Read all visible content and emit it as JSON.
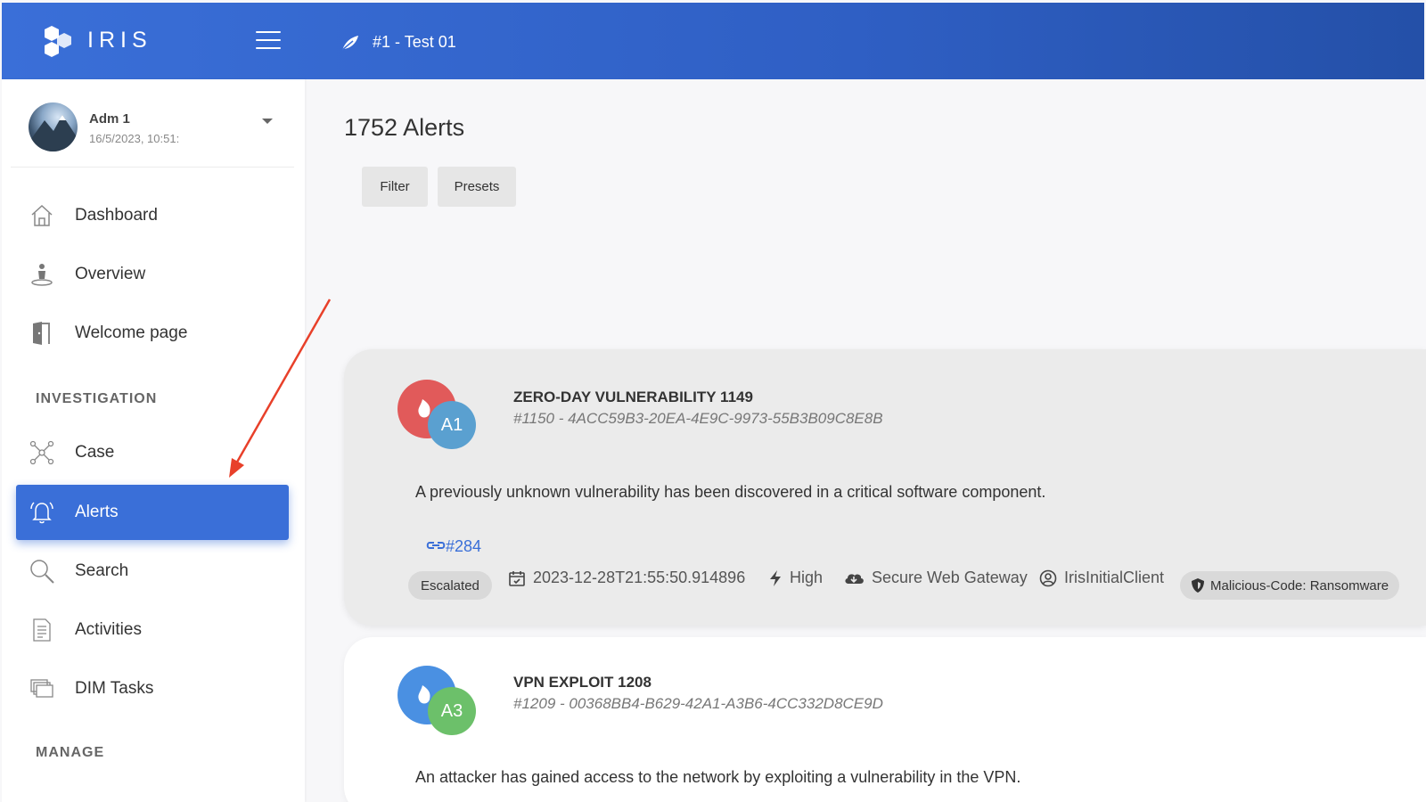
{
  "header": {
    "brand": "IRIS",
    "case_title": "#1 - Test 01"
  },
  "user": {
    "name": "Adm 1",
    "date": "16/5/2023, 10:51:"
  },
  "sidebar": {
    "items": [
      {
        "label": "Dashboard",
        "icon": "home-icon"
      },
      {
        "label": "Overview",
        "icon": "person-pin-icon"
      },
      {
        "label": "Welcome page",
        "icon": "door-icon"
      }
    ],
    "section_investigation": "INVESTIGATION",
    "investigation_items": [
      {
        "label": "Case",
        "icon": "network-icon"
      },
      {
        "label": "Alerts",
        "icon": "bell-icon",
        "active": true
      },
      {
        "label": "Search",
        "icon": "search-icon"
      },
      {
        "label": "Activities",
        "icon": "document-icon"
      },
      {
        "label": "DIM Tasks",
        "icon": "stack-icon"
      }
    ],
    "section_manage": "MANAGE"
  },
  "main": {
    "title": "1752 Alerts",
    "filter_label": "Filter",
    "presets_label": "Presets"
  },
  "alerts": [
    {
      "title": "ZERO-DAY VULNERABILITY 1149",
      "id": "#1150 - 4ACC59B3-20EA-4E9C-9973-55B3B09C8E8B",
      "badge": "A1",
      "description": "A previously unknown vulnerability has been discovered in a critical software component.",
      "link": "#284",
      "status": "Escalated",
      "timestamp": "2023-12-28T21:55:50.914896",
      "severity": "High",
      "source": "Secure Web Gateway",
      "client": "IrisInitialClient",
      "classification": "Malicious-Code: Ransomware"
    },
    {
      "title": "VPN EXPLOIT 1208",
      "id": "#1209 - 00368BB4-B629-42A1-A3B6-4CC332D8CE9D",
      "badge": "A3",
      "description": "An attacker has gained access to the network by exploiting a vulnerability in the VPN."
    }
  ],
  "colors": {
    "accent": "#3a6fd8",
    "alert_red": "#e15a5a",
    "badge_blue": "#5aa0d0",
    "badge_green": "#6cc06a",
    "annotation_arrow": "#e8402a"
  }
}
